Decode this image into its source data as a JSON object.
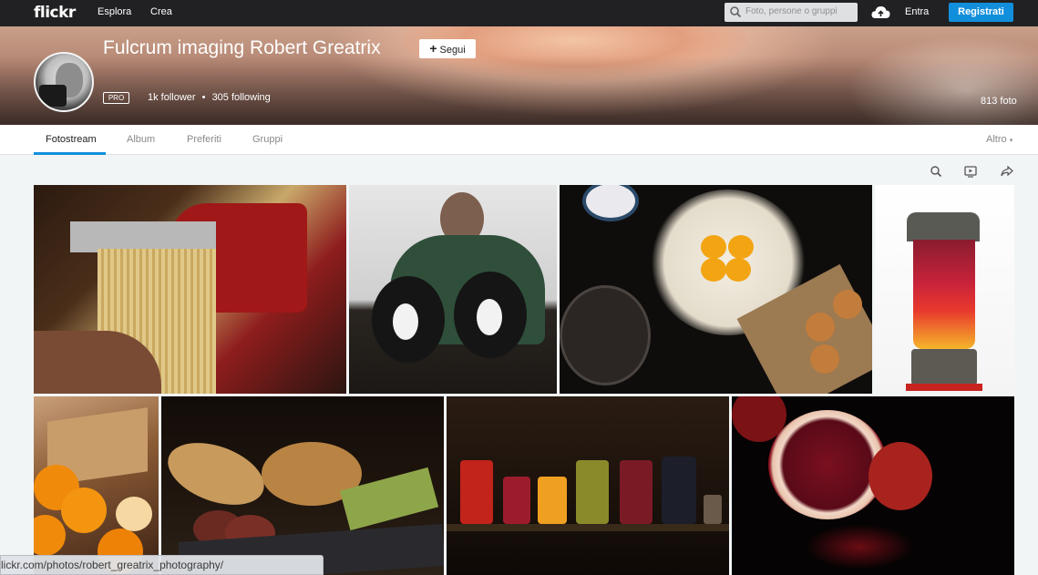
{
  "topnav": {
    "logo": "flickr",
    "explore": "Esplora",
    "create": "Crea",
    "search_placeholder": "Foto, persone o gruppi",
    "login": "Entra",
    "signup": "Registrati"
  },
  "profile": {
    "name": "Fulcrum imaging Robert Greatrix",
    "follow": "Segui",
    "pro_badge": "PRO",
    "followers": "1k follower",
    "separator": "•",
    "following": "305 following",
    "photo_count": "813 foto"
  },
  "tabs": [
    {
      "label": "Fotostream",
      "active": true
    },
    {
      "label": "Album",
      "active": false
    },
    {
      "label": "Preferiti",
      "active": false
    },
    {
      "label": "Gruppi",
      "active": false
    }
  ],
  "more": "Altro",
  "tools": [
    "search-icon",
    "slideshow-icon",
    "share-icon"
  ],
  "photos": [
    "pasta-maker-photo",
    "man-with-dogs-photo",
    "eggs-and-flour-photo",
    "blender-fruit-photo",
    "oranges-photo",
    "bread-and-salami-photo",
    "preserve-jars-photo",
    "pomegranate-photo"
  ],
  "status_url": "lickr.com/photos/robert_greatrix_photography/",
  "colors": {
    "accent": "#128fdc",
    "nav": "#212124"
  }
}
